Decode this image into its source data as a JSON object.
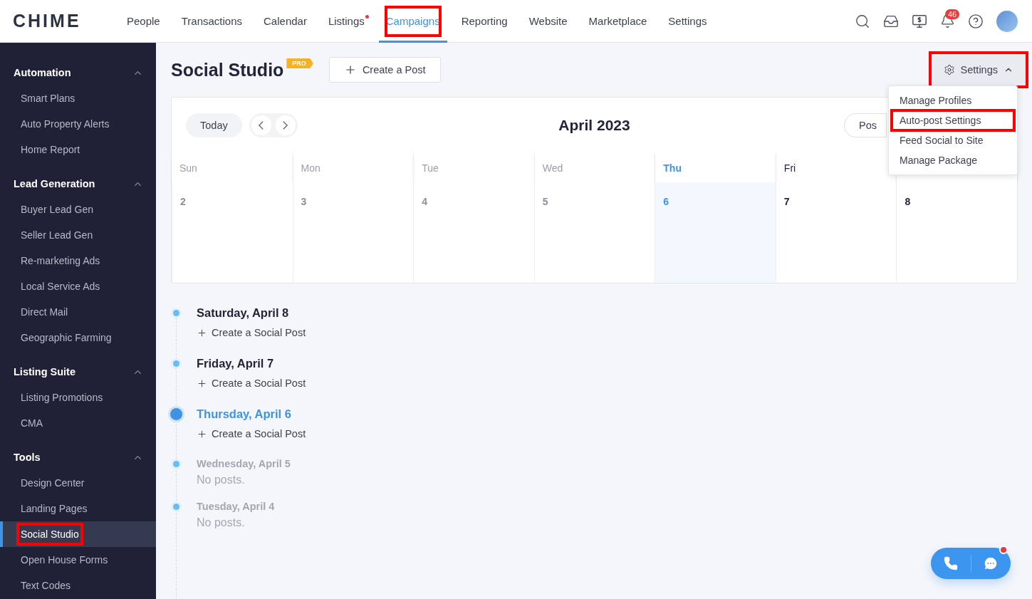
{
  "logo": "CHIME",
  "nav": [
    {
      "label": "People",
      "selected": false,
      "dot": false,
      "highlighted": false
    },
    {
      "label": "Transactions",
      "selected": false,
      "dot": false,
      "highlighted": false
    },
    {
      "label": "Calendar",
      "selected": false,
      "dot": false,
      "highlighted": false
    },
    {
      "label": "Listings",
      "selected": false,
      "dot": true,
      "highlighted": false
    },
    {
      "label": "Campaigns",
      "selected": true,
      "dot": false,
      "highlighted": true
    },
    {
      "label": "Reporting",
      "selected": false,
      "dot": false,
      "highlighted": false
    },
    {
      "label": "Website",
      "selected": false,
      "dot": false,
      "highlighted": false
    },
    {
      "label": "Marketplace",
      "selected": false,
      "dot": false,
      "highlighted": false
    },
    {
      "label": "Settings",
      "selected": false,
      "dot": false,
      "highlighted": false
    }
  ],
  "notifications": "46",
  "sidebar": [
    {
      "title": "Automation",
      "expanded": true,
      "items": [
        {
          "label": "Smart Plans",
          "selected": false,
          "highlighted": false
        },
        {
          "label": "Auto Property Alerts",
          "selected": false,
          "highlighted": false
        },
        {
          "label": "Home Report",
          "selected": false,
          "highlighted": false
        }
      ]
    },
    {
      "title": "Lead Generation",
      "expanded": true,
      "items": [
        {
          "label": "Buyer Lead Gen",
          "selected": false,
          "highlighted": false
        },
        {
          "label": "Seller Lead Gen",
          "selected": false,
          "highlighted": false
        },
        {
          "label": "Re-marketing Ads",
          "selected": false,
          "highlighted": false
        },
        {
          "label": "Local Service Ads",
          "selected": false,
          "highlighted": false
        },
        {
          "label": "Direct Mail",
          "selected": false,
          "highlighted": false
        },
        {
          "label": "Geographic Farming",
          "selected": false,
          "highlighted": false
        }
      ]
    },
    {
      "title": "Listing Suite",
      "expanded": true,
      "items": [
        {
          "label": "Listing Promotions",
          "selected": false,
          "highlighted": false
        },
        {
          "label": "CMA",
          "selected": false,
          "highlighted": false
        }
      ]
    },
    {
      "title": "Tools",
      "expanded": true,
      "items": [
        {
          "label": "Design Center",
          "selected": false,
          "highlighted": false
        },
        {
          "label": "Landing Pages",
          "selected": false,
          "highlighted": false
        },
        {
          "label": "Social Studio",
          "selected": true,
          "highlighted": true
        },
        {
          "label": "Open House Forms",
          "selected": false,
          "highlighted": false
        },
        {
          "label": "Text Codes",
          "selected": false,
          "highlighted": false
        }
      ]
    }
  ],
  "page": {
    "title": "Social Studio",
    "badge": "PRO",
    "create_button": "Create a Post"
  },
  "settings_menu": {
    "label": "Settings",
    "expanded": true,
    "highlighted": true,
    "items": [
      {
        "label": "Manage Profiles",
        "highlighted": false
      },
      {
        "label": "Auto-post Settings",
        "highlighted": true
      },
      {
        "label": "Feed Social to Site",
        "highlighted": false
      },
      {
        "label": "Manage Package",
        "highlighted": false
      }
    ]
  },
  "calendar": {
    "today_button": "Today",
    "month": "April 2023",
    "view_button": "Pos",
    "days": [
      {
        "label": "Sun",
        "date": "2",
        "today": false,
        "past": true
      },
      {
        "label": "Mon",
        "date": "3",
        "today": false,
        "past": true
      },
      {
        "label": "Tue",
        "date": "4",
        "today": false,
        "past": true
      },
      {
        "label": "Wed",
        "date": "5",
        "today": false,
        "past": true
      },
      {
        "label": "Thu",
        "date": "6",
        "today": true,
        "past": false
      },
      {
        "label": "Fri",
        "date": "7",
        "today": false,
        "past": false
      },
      {
        "date": "8",
        "today": false,
        "past": false
      }
    ]
  },
  "timeline": [
    {
      "kind": "upcoming",
      "title": "Saturday, April 8",
      "today": false,
      "action": "Create a Social Post"
    },
    {
      "kind": "upcoming",
      "title": "Friday, April 7",
      "today": false,
      "action": "Create a Social Post"
    },
    {
      "kind": "upcoming",
      "title": "Thursday, April 6",
      "today": true,
      "action": "Create a Social Post"
    },
    {
      "kind": "past",
      "title": "Wednesday, April 5",
      "today": false,
      "note": "No posts."
    },
    {
      "kind": "past",
      "title": "Tuesday, April 4",
      "today": false,
      "note": "No posts."
    }
  ]
}
